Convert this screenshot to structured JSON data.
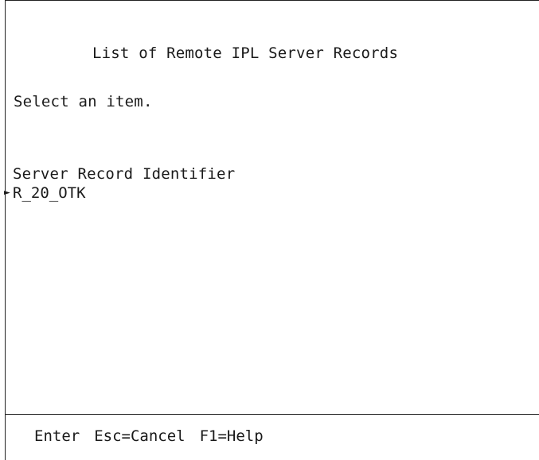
{
  "screen": {
    "title": "List of Remote IPL Server Records",
    "prompt": "Select an item.",
    "column_header": "Server Record Identifier",
    "selection_marker": "►",
    "items": [
      {
        "label": "R_20_OTK",
        "selected": true
      }
    ]
  },
  "function_keys": [
    {
      "label": "Enter"
    },
    {
      "label": "Esc=Cancel"
    },
    {
      "label": "F1=Help"
    }
  ]
}
